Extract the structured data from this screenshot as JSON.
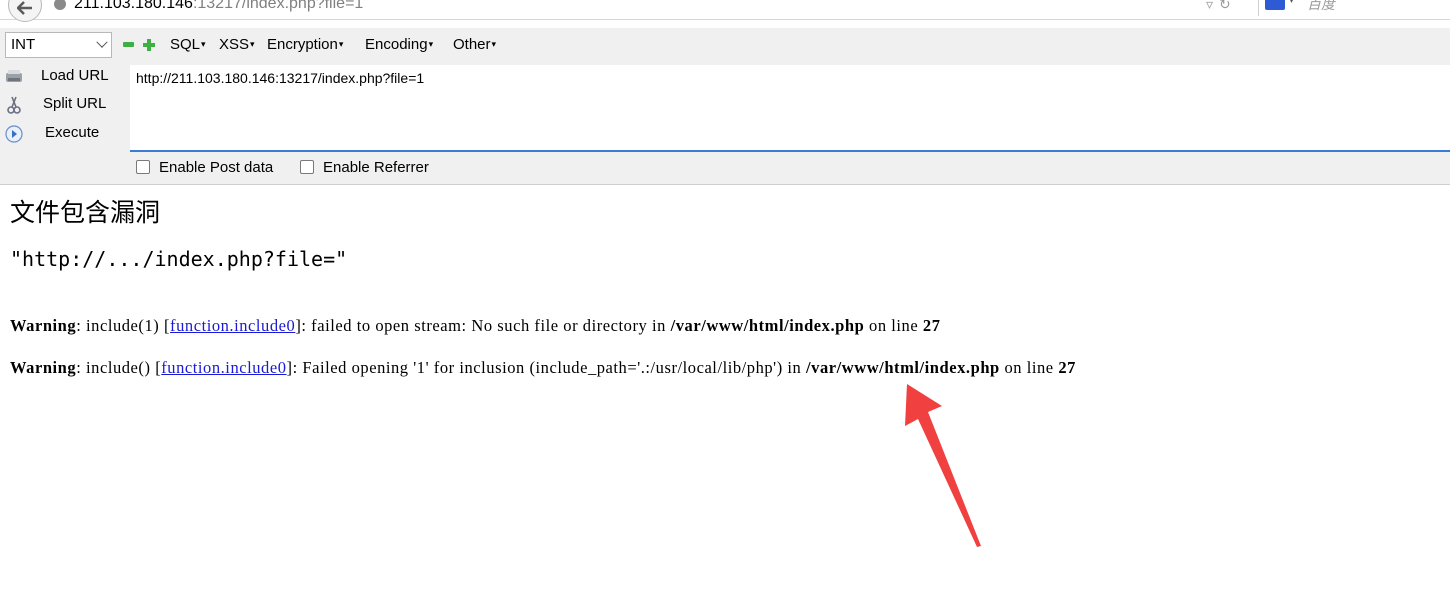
{
  "browser": {
    "url_host": "211.103.180.146",
    "url_rest": ":13217/index.php?file=1",
    "search_placeholder": "百度"
  },
  "hackbar": {
    "select_value": "INT",
    "menus": [
      "SQL",
      "XSS",
      "Encryption",
      "Encoding",
      "Other"
    ],
    "buttons": {
      "load": "Load URL",
      "split": "Split URL",
      "execute": "Execute"
    },
    "url_value": "http://211.103.180.146:13217/index.php?file=1",
    "enable_post": "Enable Post data",
    "enable_referrer": "Enable Referrer"
  },
  "page": {
    "title": "文件包含漏洞",
    "subtitle": "\"http://.../index.php?file=\"",
    "warnings": [
      {
        "label": "Warning",
        "pre": ": include(1) [",
        "link": "function.include0",
        "post": "]: failed to open stream: No such file or directory in ",
        "file": "/var/www/html/index.php",
        "on_line": " on line ",
        "line": "27"
      },
      {
        "label": "Warning",
        "pre": ": include() [",
        "link": "function.include0",
        "post": "]: Failed opening '1' for inclusion (include_path='.:/usr/local/lib/php') in ",
        "file": "/var/www/html/index.php",
        "on_line": " on line ",
        "line": "27"
      }
    ]
  },
  "colors": {
    "accent": "#3a7bd5",
    "link": "#1a1ad6",
    "annotation_arrow": "#f04040",
    "toolbar_icon": "#3cb043"
  }
}
